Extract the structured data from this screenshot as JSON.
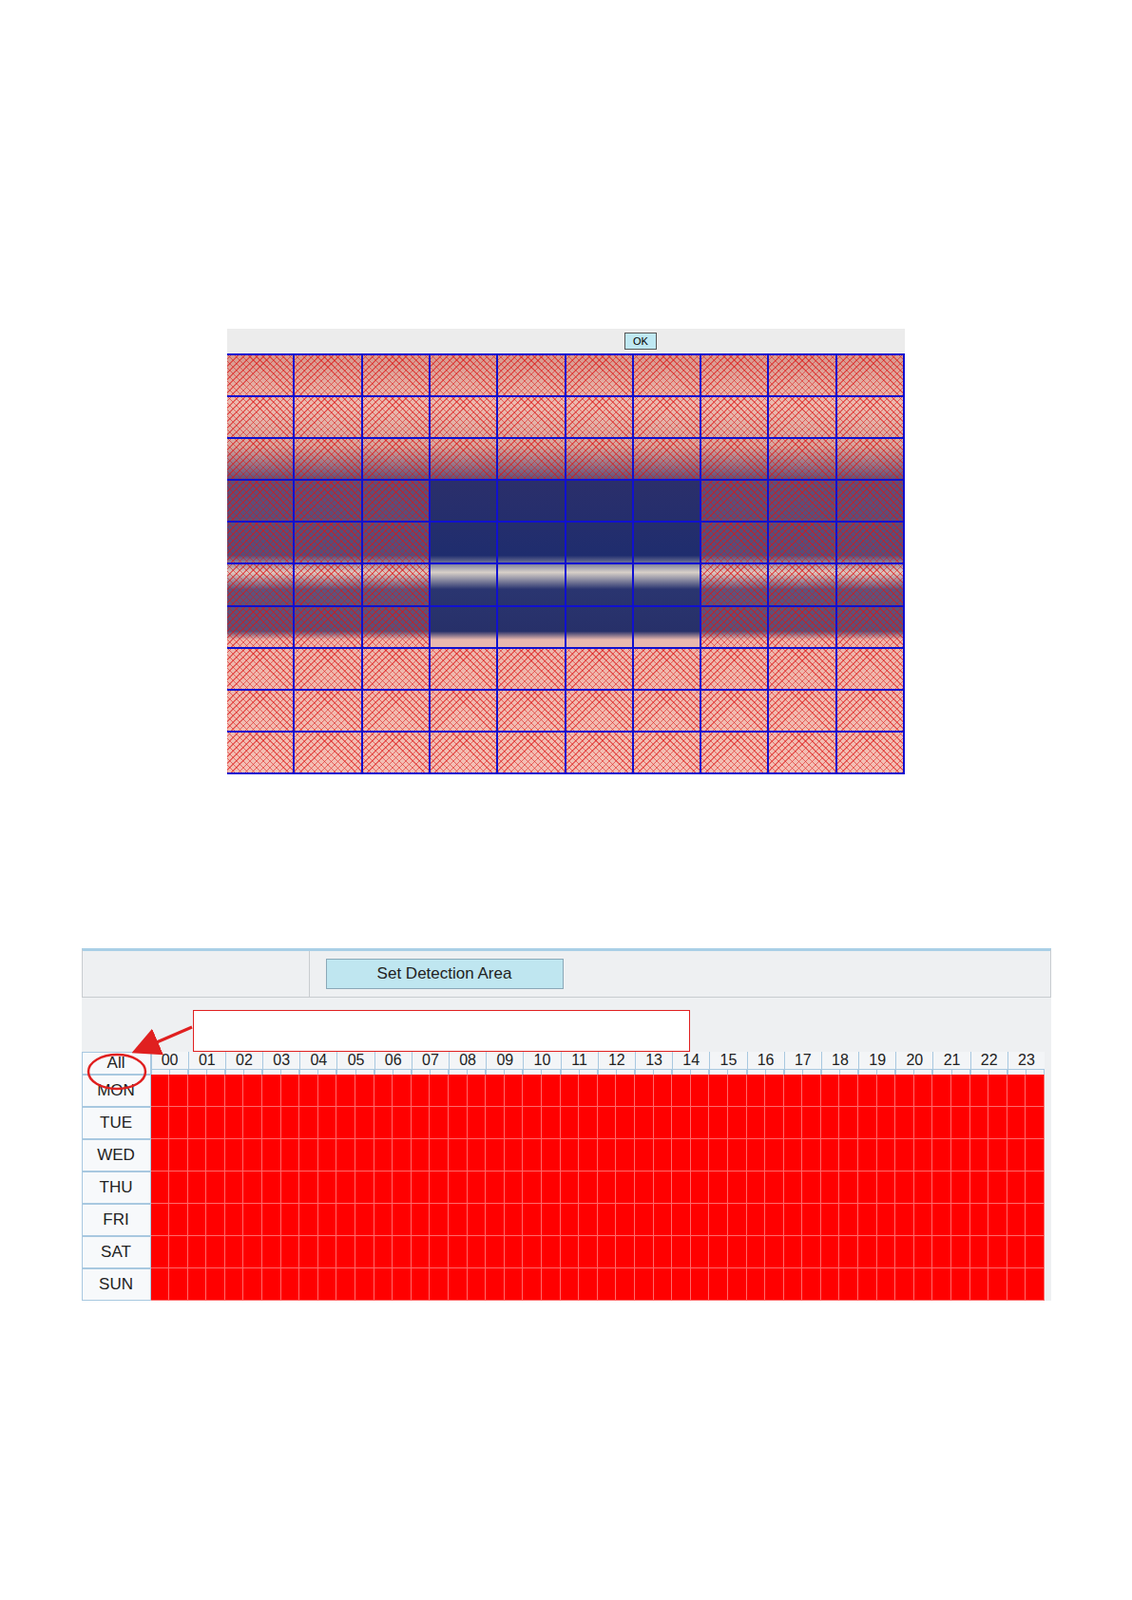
{
  "detection_area": {
    "button": "OK",
    "cells": [
      [
        true,
        true,
        true,
        true,
        true,
        true,
        true,
        true,
        true,
        true
      ],
      [
        true,
        true,
        true,
        true,
        true,
        true,
        true,
        true,
        true,
        true
      ],
      [
        true,
        true,
        true,
        true,
        true,
        true,
        true,
        true,
        true,
        true
      ],
      [
        true,
        true,
        true,
        false,
        false,
        false,
        false,
        true,
        true,
        true
      ],
      [
        true,
        true,
        true,
        false,
        false,
        false,
        false,
        true,
        true,
        true
      ],
      [
        true,
        true,
        true,
        false,
        false,
        false,
        false,
        true,
        true,
        true
      ],
      [
        true,
        true,
        true,
        false,
        false,
        false,
        false,
        true,
        true,
        true
      ],
      [
        true,
        true,
        true,
        true,
        true,
        true,
        true,
        true,
        true,
        true
      ],
      [
        true,
        true,
        true,
        true,
        true,
        true,
        true,
        true,
        true,
        true
      ],
      [
        true,
        true,
        true,
        true,
        true,
        true,
        true,
        true,
        true,
        true
      ]
    ]
  },
  "schedule": {
    "button": "Set Detection Area",
    "all_label": "All",
    "hours": [
      "00",
      "01",
      "02",
      "03",
      "04",
      "05",
      "06",
      "07",
      "08",
      "09",
      "10",
      "11",
      "12",
      "13",
      "14",
      "15",
      "16",
      "17",
      "18",
      "19",
      "20",
      "21",
      "22",
      "23"
    ],
    "days": [
      {
        "label": "MON",
        "slots": [
          true,
          true,
          true,
          true,
          true,
          true,
          true,
          true,
          true,
          true,
          true,
          true,
          true,
          true,
          true,
          true,
          true,
          true,
          true,
          true,
          true,
          true,
          true,
          true,
          true,
          true,
          true,
          true,
          true,
          true,
          true,
          true,
          true,
          true,
          true,
          true,
          true,
          true,
          true,
          true,
          true,
          true,
          true,
          true,
          true,
          true,
          true,
          true
        ]
      },
      {
        "label": "TUE",
        "slots": [
          true,
          true,
          true,
          true,
          true,
          true,
          true,
          true,
          true,
          true,
          true,
          true,
          true,
          true,
          true,
          true,
          true,
          true,
          true,
          true,
          true,
          true,
          true,
          true,
          true,
          true,
          true,
          true,
          true,
          true,
          true,
          true,
          true,
          true,
          true,
          true,
          true,
          true,
          true,
          true,
          true,
          true,
          true,
          true,
          true,
          true,
          true,
          true
        ]
      },
      {
        "label": "WED",
        "slots": [
          true,
          true,
          true,
          true,
          true,
          true,
          true,
          true,
          true,
          true,
          true,
          true,
          true,
          true,
          true,
          true,
          true,
          true,
          true,
          true,
          true,
          true,
          true,
          true,
          true,
          true,
          true,
          true,
          true,
          true,
          true,
          true,
          true,
          true,
          true,
          true,
          true,
          true,
          true,
          true,
          true,
          true,
          true,
          true,
          true,
          true,
          true,
          true
        ]
      },
      {
        "label": "THU",
        "slots": [
          true,
          true,
          true,
          true,
          true,
          true,
          true,
          true,
          true,
          true,
          true,
          true,
          true,
          true,
          true,
          true,
          true,
          true,
          true,
          true,
          true,
          true,
          true,
          true,
          true,
          true,
          true,
          true,
          true,
          true,
          true,
          true,
          true,
          true,
          true,
          true,
          true,
          true,
          true,
          true,
          true,
          true,
          true,
          true,
          true,
          true,
          true,
          true
        ]
      },
      {
        "label": "FRI",
        "slots": [
          true,
          true,
          true,
          true,
          true,
          true,
          true,
          true,
          true,
          true,
          true,
          true,
          true,
          true,
          true,
          true,
          true,
          true,
          true,
          true,
          true,
          true,
          true,
          true,
          true,
          true,
          true,
          true,
          true,
          true,
          true,
          true,
          true,
          true,
          true,
          true,
          true,
          true,
          true,
          true,
          true,
          true,
          true,
          true,
          true,
          true,
          true,
          true
        ]
      },
      {
        "label": "SAT",
        "slots": [
          true,
          true,
          true,
          true,
          true,
          true,
          true,
          true,
          true,
          true,
          true,
          true,
          true,
          true,
          true,
          true,
          true,
          true,
          true,
          true,
          true,
          true,
          true,
          true,
          true,
          true,
          true,
          true,
          true,
          true,
          true,
          true,
          true,
          true,
          true,
          true,
          true,
          true,
          true,
          true,
          true,
          true,
          true,
          true,
          true,
          true,
          true,
          true
        ]
      },
      {
        "label": "SUN",
        "slots": [
          true,
          true,
          true,
          true,
          true,
          true,
          true,
          true,
          true,
          true,
          true,
          true,
          true,
          true,
          true,
          true,
          true,
          true,
          true,
          true,
          true,
          true,
          true,
          true,
          true,
          true,
          true,
          true,
          true,
          true,
          true,
          true,
          true,
          true,
          true,
          true,
          true,
          true,
          true,
          true,
          true,
          true,
          true,
          true,
          true,
          true,
          true,
          true
        ]
      }
    ]
  }
}
